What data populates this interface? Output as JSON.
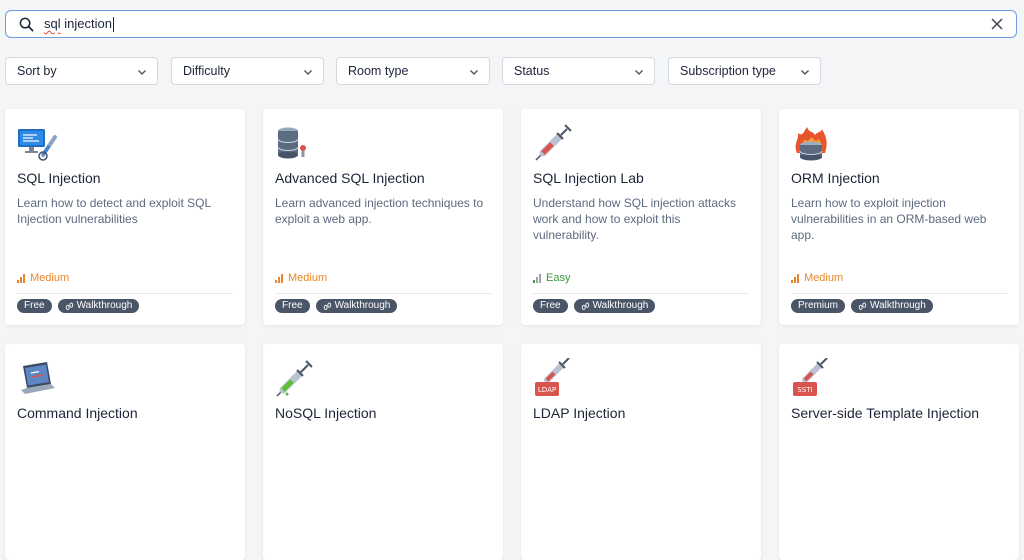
{
  "search": {
    "query_underlined": "sql",
    "query_rest": " injection"
  },
  "filters": [
    {
      "label": "Sort by"
    },
    {
      "label": "Difficulty"
    },
    {
      "label": "Room type"
    },
    {
      "label": "Status"
    },
    {
      "label": "Subscription type"
    }
  ],
  "rooms": [
    {
      "title": "SQL Injection",
      "description": "Learn how to detect and exploit SQL Injection vulnerabilities",
      "difficulty": "Medium",
      "tags": [
        "Free",
        "Walkthrough"
      ],
      "icon": "monitor-syringe-icon"
    },
    {
      "title": "Advanced SQL Injection",
      "description": "Learn advanced injection techniques to exploit a web app.",
      "difficulty": "Medium",
      "tags": [
        "Free",
        "Walkthrough"
      ],
      "icon": "database-icon"
    },
    {
      "title": "SQL Injection Lab",
      "description": "Understand how SQL injection attacks work and how to exploit this vulnerability.",
      "difficulty": "Easy",
      "tags": [
        "Free",
        "Walkthrough"
      ],
      "icon": "syringe-icon"
    },
    {
      "title": "ORM Injection",
      "description": "Learn how to exploit injection vulnerabilities in an ORM-based web app.",
      "difficulty": "Medium",
      "tags": [
        "Premium",
        "Walkthrough"
      ],
      "icon": "burning-database-icon"
    },
    {
      "title": "Command Injection",
      "description": "",
      "difficulty": "",
      "tags": [],
      "icon": "laptop-icon"
    },
    {
      "title": "NoSQL Injection",
      "description": "",
      "difficulty": "",
      "tags": [],
      "icon": "green-syringe-icon"
    },
    {
      "title": "LDAP Injection",
      "description": "",
      "difficulty": "",
      "tags": [],
      "icon": "ldap-syringe-icon"
    },
    {
      "title": "Server-side Template Injection",
      "description": "",
      "difficulty": "",
      "tags": [],
      "icon": "ssti-syringe-icon"
    }
  ],
  "colors": {
    "accent_border": "#6f9de0",
    "medium": "#e8852a",
    "easy": "#3d9a3d",
    "tag_bg": "#4a5568"
  }
}
